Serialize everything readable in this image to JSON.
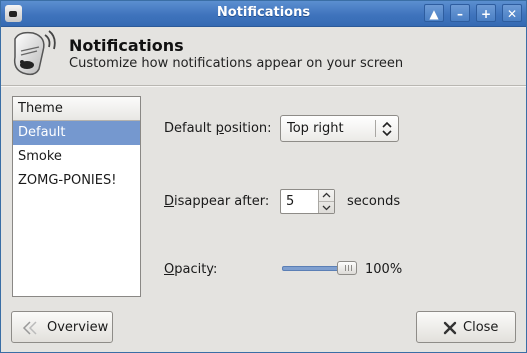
{
  "window": {
    "title": "Notifications",
    "controls": [
      "restore",
      "minimize",
      "maximize",
      "close"
    ]
  },
  "header": {
    "title": "Notifications",
    "subtitle": "Customize how notifications appear on your screen",
    "icon": "notification-bubble-icon"
  },
  "themes": {
    "header": "Theme",
    "items": [
      "Default",
      "Smoke",
      "ZOMG-PONIES!"
    ],
    "selected": "Default"
  },
  "settings": {
    "position_label_pre": "Default ",
    "position_label_mnemonic": "p",
    "position_label_post": "osition:",
    "position_value": "Top right",
    "disappear_label_mnemonic": "D",
    "disappear_label_post": "isappear after:",
    "disappear_value": "5",
    "disappear_unit": "seconds",
    "opacity_label_mnemonic": "O",
    "opacity_label_post": "pacity:",
    "opacity_value": "100%",
    "opacity_fraction": 1.0
  },
  "buttons": {
    "overview": "Overview",
    "close": "Close"
  },
  "colors": {
    "titlebar": "#3f74bd",
    "selection": "#7598cf",
    "background": "#e4e3e0"
  }
}
